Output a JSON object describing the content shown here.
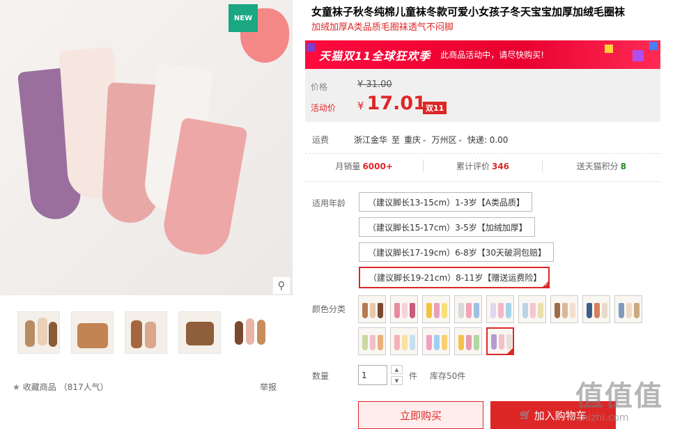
{
  "product": {
    "title": "女童袜子秋冬纯棉儿童袜冬款可爱小女孩子冬天宝宝加厚加绒毛圈袜",
    "subtitle": "加绒加厚A类品质毛圈袜透气不闷脚",
    "badge_new": "NEW",
    "zoom_icon": "magnifier-icon"
  },
  "favorite": {
    "label": "收藏商品",
    "count": "（817人气）",
    "report": "举报"
  },
  "banner": {
    "logo": "天猫双11全球狂欢季",
    "text": "此商品活动中，请尽快购买!"
  },
  "price": {
    "label": "价格",
    "original": "¥ 31.00",
    "promo_label": "活动价",
    "currency": "¥",
    "promo": "17.01",
    "tag": "双11"
  },
  "shipping": {
    "label": "运费",
    "from": "浙江金华",
    "to": "至",
    "province": "重庆",
    "district": "万州区",
    "fee": "快递: 0.00"
  },
  "stats": {
    "monthly_sales_label": "月销量",
    "monthly_sales": "6000+",
    "reviews_label": "累计评价",
    "reviews": "346",
    "points_label": "送天猫积分",
    "points": "8"
  },
  "age": {
    "label": "适用年龄",
    "options": [
      "（建议脚长13-15cm）1-3岁【A类品质】",
      "（建议脚长15-17cm）3-5岁【加绒加厚】",
      "（建议脚长17-19cm）6-8岁【30天破洞包赔】",
      "（建议脚长19-21cm）8-11岁【赠送运费险】"
    ],
    "selected_index": 3
  },
  "color": {
    "label": "颜色分类",
    "swatch_count": 14,
    "selected_index": 13
  },
  "quantity": {
    "label": "数量",
    "value": "1",
    "unit": "件",
    "stock": "库存50件"
  },
  "actions": {
    "buy_now": "立即购买",
    "add_to_cart": "加入购物车"
  },
  "watermark": {
    "text": "值值值",
    "url": "zhizhi.com"
  },
  "colors": {
    "accent": "#dd2727",
    "banner": "#ff0a3e",
    "new_badge": "#1aa782"
  }
}
